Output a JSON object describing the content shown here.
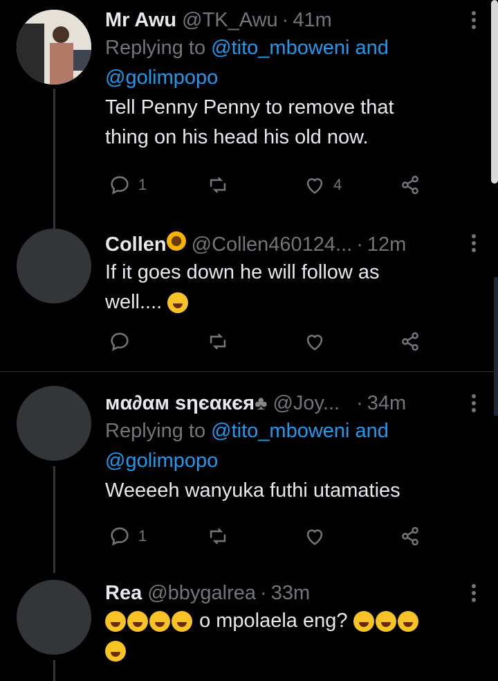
{
  "tweets": [
    {
      "name": "Mr Awu",
      "handle": "@TK_Awu",
      "dot": "·",
      "time": "41m",
      "replying_prefix": "Replying to ",
      "replying_user1": "@tito_mboweni",
      "replying_and": " and",
      "replying_user2": "@golimpopo",
      "text_line1": "Tell Penny Penny to remove that",
      "text_line2": "thing on his head his old now.",
      "reply_count": "1",
      "retweet_count": "",
      "like_count": "4"
    },
    {
      "name": "Collen",
      "handle": "@Collen460124...",
      "dot": "·",
      "time": "12m",
      "text_line1": "If it goes down he will follow as",
      "text_line2": "well....",
      "reply_count": "",
      "like_count": ""
    },
    {
      "name": "мα∂αм ѕηєαкєя",
      "handle": "@Joy...",
      "dot": "·",
      "time": "34m",
      "replying_prefix": "Replying to ",
      "replying_user1": "@tito_mboweni",
      "replying_and": " and",
      "replying_user2": "@golimpopo",
      "text_line1": "Weeeeh wanyuka futhi utamaties",
      "reply_count": "1",
      "like_count": ""
    },
    {
      "name": "Rea",
      "handle": "@bbygalrea",
      "dot": "·",
      "time": "33m",
      "text_line1": "o mpolaela eng?"
    }
  ],
  "colors": {
    "link": "#1d9bf0",
    "muted": "#71767b",
    "text": "#e7e9ea",
    "background": "#000000"
  }
}
